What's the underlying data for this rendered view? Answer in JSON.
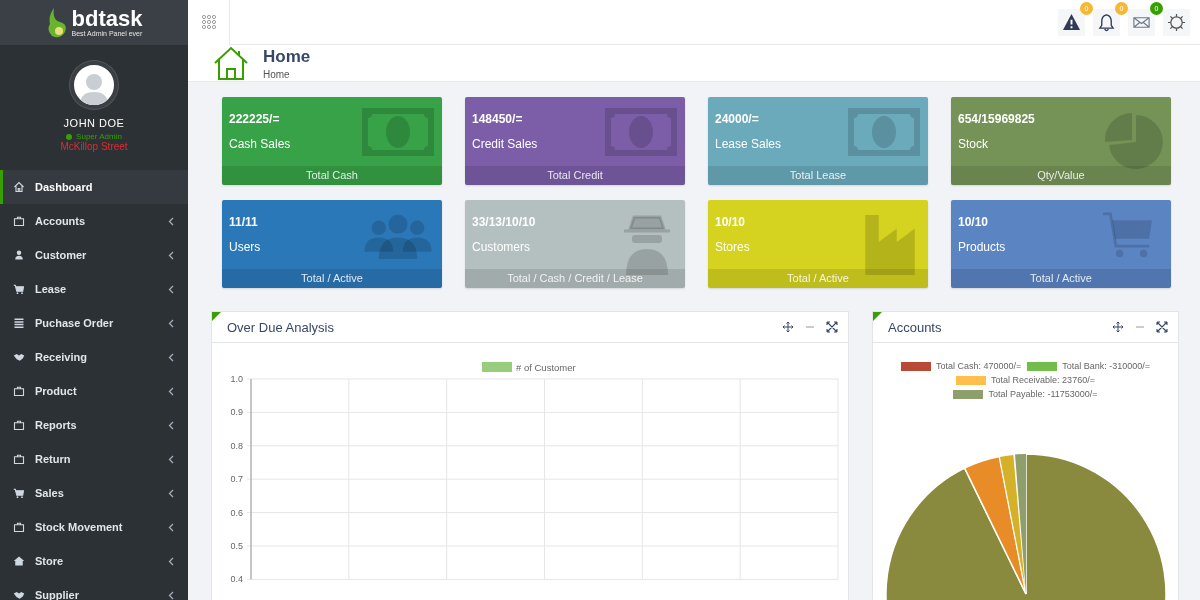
{
  "brand": {
    "name": "bdtask",
    "tagline": "Best Admin Panel ever"
  },
  "user": {
    "name": "JOHN DOE",
    "role": "Super Admin",
    "online": true,
    "location": "McKillop Street"
  },
  "sidebar": {
    "items": [
      {
        "label": "Dashboard",
        "selected": true,
        "submenu": false
      },
      {
        "label": "Accounts",
        "selected": false,
        "submenu": true
      },
      {
        "label": "Customer",
        "selected": false,
        "submenu": true
      },
      {
        "label": "Lease",
        "selected": false,
        "submenu": true
      },
      {
        "label": "Puchase Order",
        "selected": false,
        "submenu": true
      },
      {
        "label": "Receiving",
        "selected": false,
        "submenu": true
      },
      {
        "label": "Product",
        "selected": false,
        "submenu": true
      },
      {
        "label": "Reports",
        "selected": false,
        "submenu": true
      },
      {
        "label": "Return",
        "selected": false,
        "submenu": true
      },
      {
        "label": "Sales",
        "selected": false,
        "submenu": true
      },
      {
        "label": "Stock Movement",
        "selected": false,
        "submenu": true
      },
      {
        "label": "Store",
        "selected": false,
        "submenu": true
      },
      {
        "label": "Supplier",
        "selected": false,
        "submenu": true
      }
    ]
  },
  "topbar": {
    "icons": [
      {
        "badge": "0",
        "color": "#f7b731"
      },
      {
        "badge": "0",
        "color": "#f7b731"
      },
      {
        "badge": "0",
        "color": "#37a000"
      }
    ]
  },
  "header": {
    "title": "Home",
    "breadcrumb": "Home"
  },
  "cards": [
    {
      "value": "222225/=",
      "label": "Cash Sales",
      "footer": "Total Cash",
      "color": "#37a247"
    },
    {
      "value": "148450/=",
      "label": "Credit Sales",
      "footer": "Total Credit",
      "color": "#7b5ea7"
    },
    {
      "value": "24000/=",
      "label": "Lease Sales",
      "footer": "Total Lease",
      "color": "#6aaabb"
    },
    {
      "value": "654/15969825",
      "label": "Stock",
      "footer": "Qty/Value",
      "color": "#759357"
    },
    {
      "value": "11/11",
      "label": "Users",
      "footer": "Total / Active",
      "color": "#2b78b8"
    },
    {
      "value": "33/13/10/10",
      "label": "Customers",
      "footer": "Total / Cash / Credit / Lease",
      "color": "#b4bfbf"
    },
    {
      "value": "10/10",
      "label": "Stores",
      "footer": "Total / Active",
      "color": "#d5d31f"
    },
    {
      "value": "10/10",
      "label": "Products",
      "footer": "Total / Active",
      "color": "#5b84c3"
    }
  ],
  "overdue_panel": {
    "title": "Over Due Analysis",
    "chart_data": {
      "type": "bar",
      "series": [
        {
          "name": "# of Customer",
          "color": "#97cd7c"
        }
      ],
      "grid": true,
      "ylim": [
        0.4,
        1.0
      ],
      "yticks": [
        {
          "value": 1.0,
          "label": "1.0"
        },
        {
          "value": 0.9,
          "label": "0.9"
        },
        {
          "value": 0.8,
          "label": "0.8"
        },
        {
          "value": 0.7,
          "label": "0.7"
        },
        {
          "value": 0.6,
          "label": "0.6"
        },
        {
          "value": 0.5,
          "label": "0.5"
        },
        {
          "value": 0.4,
          "label": "0.4"
        }
      ]
    }
  },
  "accounts_panel": {
    "title": "Accounts",
    "legend": [
      {
        "label": "Total Cash: 470000/=",
        "color": "#b94a35"
      },
      {
        "label": "Total Bank: -310000/=",
        "color": "#72bd4c"
      },
      {
        "label": "Total Receivable: 23760/=",
        "color": "#ffbf4a"
      },
      {
        "label": "Total Payable: -11753000/=",
        "color": "#8f9f6c"
      }
    ]
  }
}
